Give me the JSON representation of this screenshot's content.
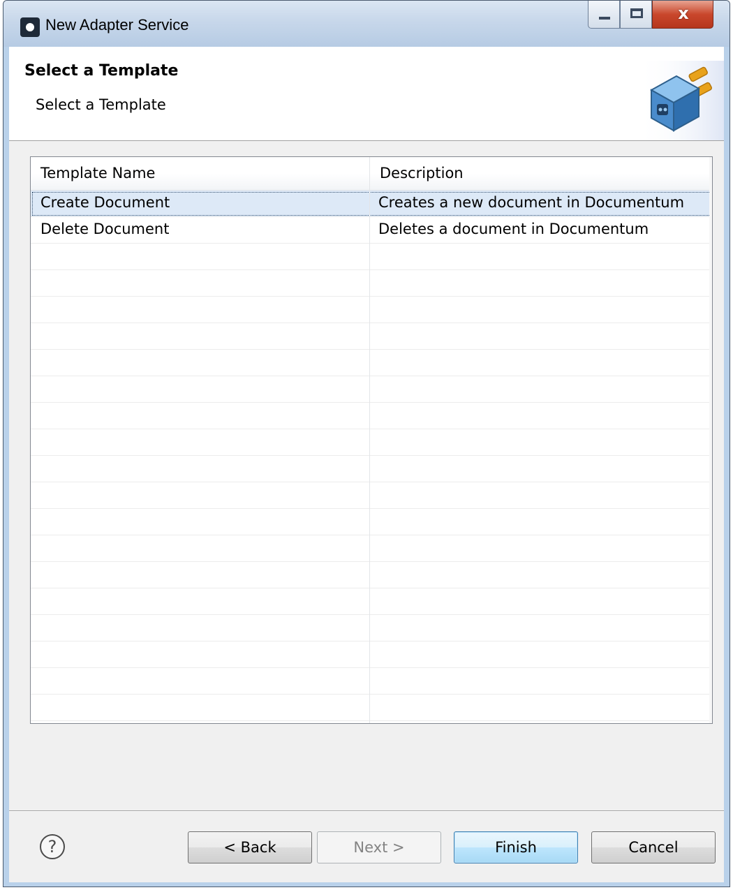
{
  "window": {
    "title": "New Adapter Service",
    "close_glyph": "x"
  },
  "header": {
    "title": "Select a Template",
    "subtitle": "Select a Template",
    "banner_icon": "adapter-plug-icon"
  },
  "table": {
    "columns": [
      "Template Name",
      "Description"
    ],
    "rows": [
      {
        "name": "Create Document",
        "description": "Creates a new document in Documentum",
        "selected": true
      },
      {
        "name": "Delete Document",
        "description": "Deletes a document in Documentum",
        "selected": false
      }
    ],
    "empty_row_count": 18
  },
  "footer": {
    "help_glyph": "?",
    "back_label": "< Back",
    "next_label": "Next >",
    "finish_label": "Finish",
    "cancel_label": "Cancel"
  },
  "colors": {
    "selection": "#dde9f7",
    "default_button_border": "#3c7fb1",
    "close_button": "#c9472c"
  }
}
